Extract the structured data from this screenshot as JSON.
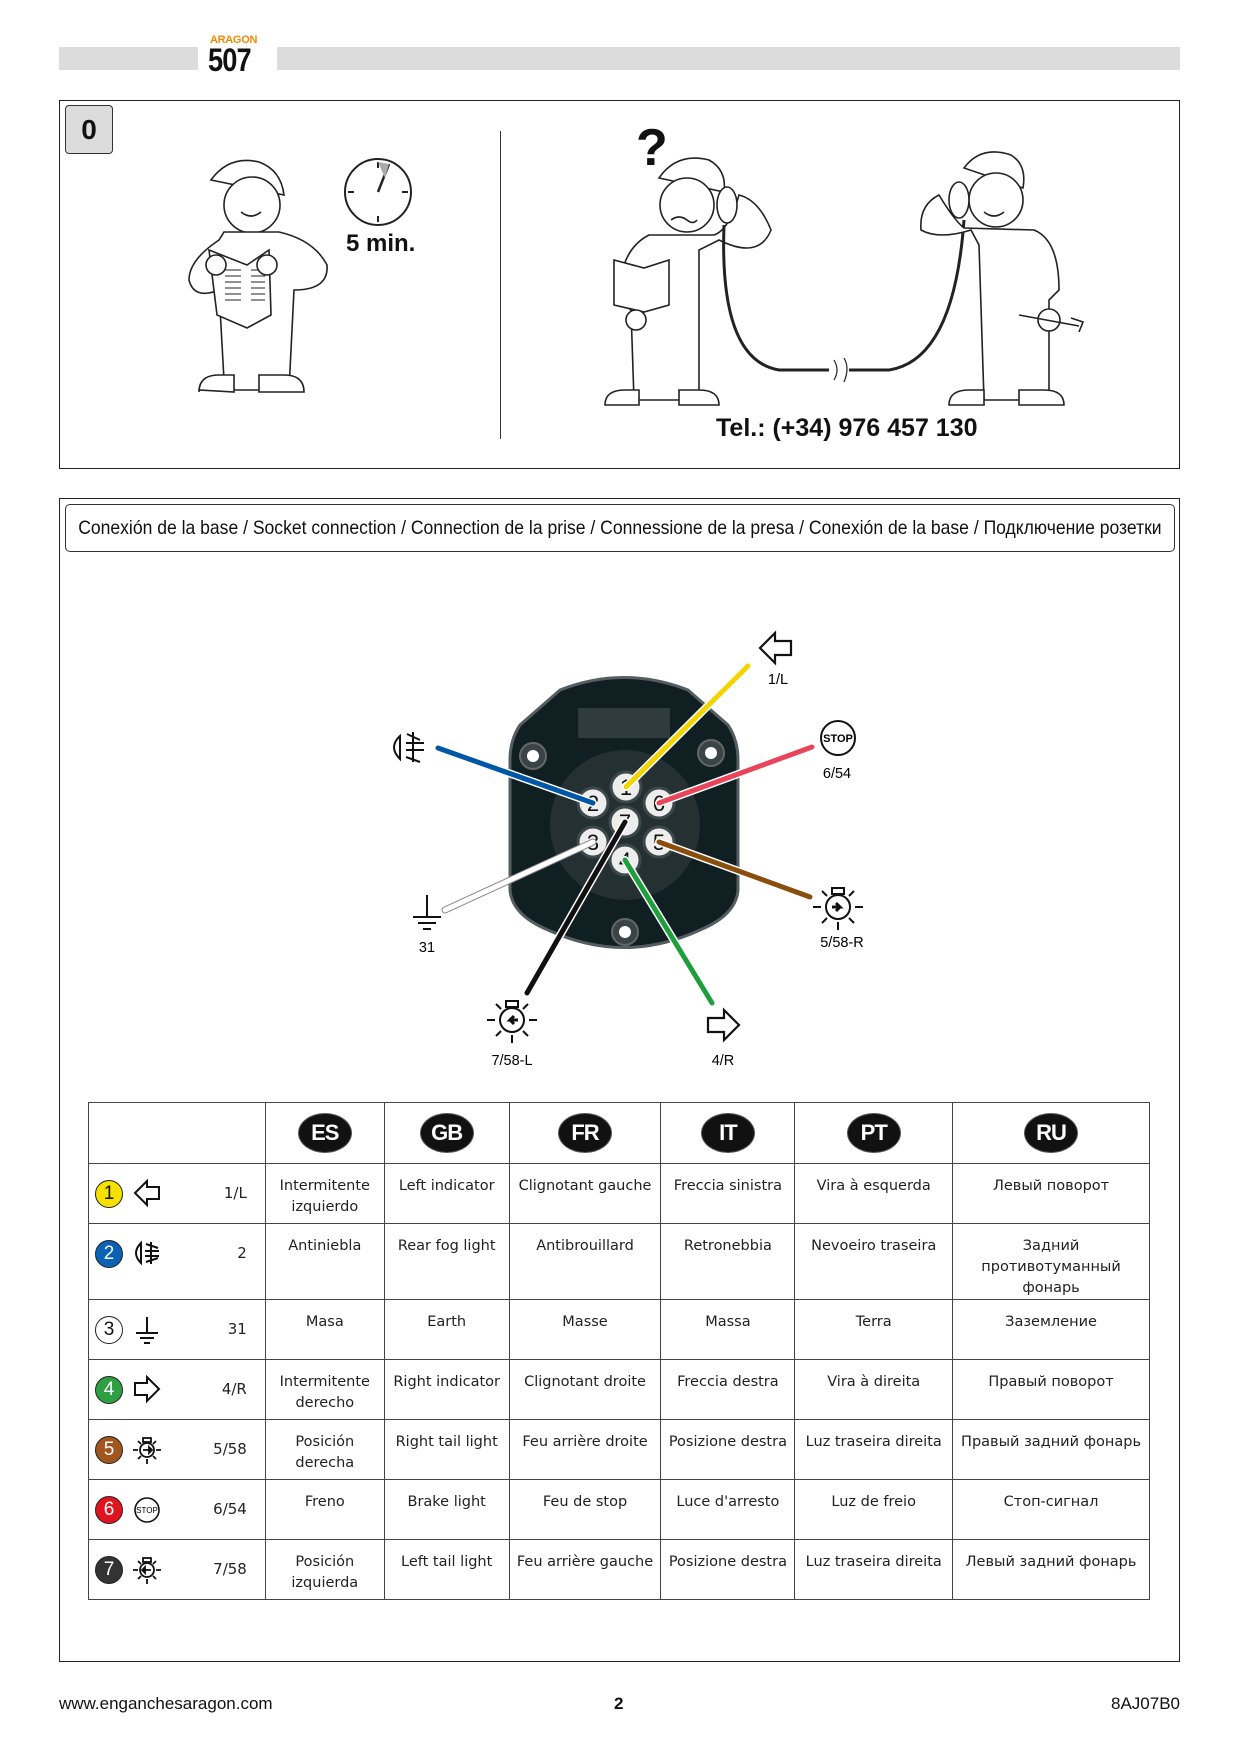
{
  "header": {
    "brand": "ARAGON",
    "model": "507"
  },
  "step1": {
    "step_number": "0",
    "time_label": "5 min.",
    "question_mark": "?",
    "phone": "Tel.: (+34) 976 457 130"
  },
  "section": {
    "title": "Conexión de la base / Socket connection / Connection de la prise / Connessione de la presa / Conexión de la base / Подключение розетки"
  },
  "diagram": {
    "pins": [
      {
        "pin": "1",
        "label": "1/L",
        "wire_color": "#f2d400",
        "icon": "left-arrow-icon"
      },
      {
        "pin": "2",
        "label": "",
        "wire_color": "#0057a8",
        "icon": "fog-light-icon"
      },
      {
        "pin": "3",
        "label": "31",
        "wire_color": "#ffffff",
        "icon": "ground-icon"
      },
      {
        "pin": "4",
        "label": "4/R",
        "wire_color": "#1f9e3c",
        "icon": "right-arrow-icon"
      },
      {
        "pin": "5",
        "label": "5/58-R",
        "wire_color": "#8a4e0c",
        "icon": "right-tail-light-icon"
      },
      {
        "pin": "6",
        "label": "6/54",
        "wire_color": "#e8455a",
        "icon": "stop-icon"
      },
      {
        "pin": "7",
        "label": "7/58-L",
        "wire_color": "#111111",
        "icon": "left-tail-light-icon"
      }
    ],
    "stop_text": "STOP"
  },
  "table": {
    "languages": [
      "ES",
      "GB",
      "FR",
      "IT",
      "PT",
      "RU"
    ],
    "rows": [
      {
        "pin": "1",
        "color": "#f5e000",
        "text_color": "#111",
        "icon": "left-arrow-icon",
        "code": "1/L",
        "cells": [
          "Intermitente izquierdo",
          "Left indicator",
          "Clignotant gauche",
          "Freccia sinistra",
          "Vira à esquerda",
          "Левый поворот"
        ]
      },
      {
        "pin": "2",
        "color": "#0a62b4",
        "text_color": "#fff",
        "icon": "fog-light-icon",
        "code": "2",
        "cells": [
          "Antiniebla",
          "Rear fog light",
          "Antibrouillard",
          "Retronebbia",
          "Nevoeiro traseira",
          "Задний противотуманный фонарь"
        ]
      },
      {
        "pin": "3",
        "color": "#ffffff",
        "text_color": "#111",
        "icon": "ground-icon",
        "code": "31",
        "cells": [
          "Masa",
          "Earth",
          "Masse",
          "Massa",
          "Terra",
          "Заземление"
        ]
      },
      {
        "pin": "4",
        "color": "#2ea043",
        "text_color": "#fff",
        "icon": "right-arrow-icon",
        "code": "4/R",
        "cells": [
          "Intermitente derecho",
          "Right indicator",
          "Clignotant droite",
          "Freccia destra",
          "Vira à direita",
          "Правый поворот"
        ]
      },
      {
        "pin": "5",
        "color": "#a0561c",
        "text_color": "#fff",
        "icon": "right-tail-light-icon",
        "code": "5/58",
        "cells": [
          "Posición derecha",
          "Right tail light",
          "Feu arrière droite",
          "Posizione destra",
          "Luz traseira direita",
          "Правый задний фонарь"
        ]
      },
      {
        "pin": "6",
        "color": "#e0141e",
        "text_color": "#fff",
        "icon": "stop-icon",
        "code": "6/54",
        "cells": [
          "Freno",
          "Brake light",
          "Feu de stop",
          "Luce d'arresto",
          "Luz de freio",
          "Стоп-сигнал"
        ]
      },
      {
        "pin": "7",
        "color": "#333333",
        "text_color": "#fff",
        "icon": "left-tail-light-icon",
        "code": "7/58",
        "cells": [
          "Posición izquierda",
          "Left tail light",
          "Feu arrière gauche",
          "Posizione destra",
          "Luz traseira direita",
          "Левый задний фонарь"
        ]
      }
    ]
  },
  "footer": {
    "website": "www.enganchesaragon.com",
    "page": "2",
    "doc_code": "8AJ07B0"
  }
}
